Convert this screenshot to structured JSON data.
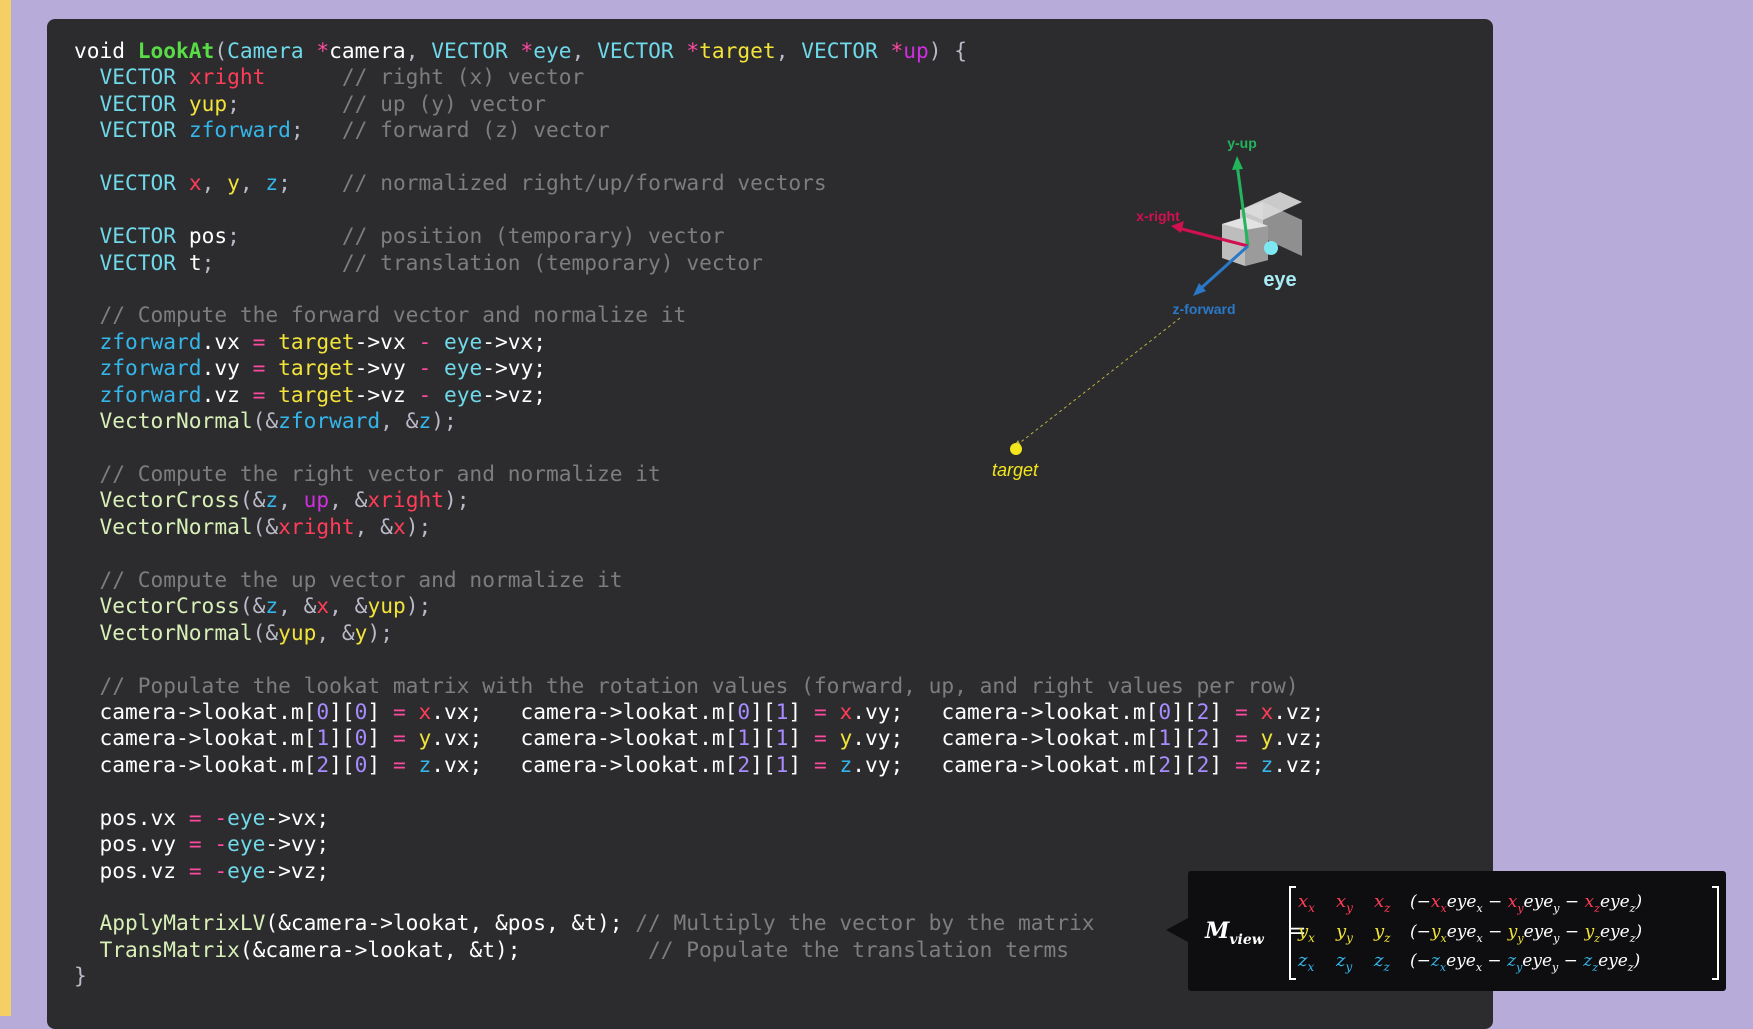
{
  "colors": {
    "background": "#b6abd9",
    "panel": "#2c2c2e",
    "left_stripe": "#f3cf66",
    "keyword": "#ffffff",
    "type": "#6fd8e9",
    "function_name": "#59dd46",
    "call": "#d8f0b8",
    "operator": "#ff4aa2",
    "comment": "#7d7d7d",
    "x_red": "#ff3d58",
    "y_yellow": "#f2e33a",
    "z_cyan": "#34b6ea",
    "up_magenta": "#d02ee0",
    "number": "#a78cff"
  },
  "code": {
    "lines": [
      [
        [
          "void ",
          "t-kw"
        ],
        [
          "LookAt",
          "t-fn"
        ],
        [
          "(",
          "t-pu"
        ],
        [
          "Camera ",
          "t-ty"
        ],
        [
          "*",
          "t-op"
        ],
        [
          "camera",
          "t-wh"
        ],
        [
          ", ",
          "t-pu"
        ],
        [
          "VECTOR ",
          "t-ty"
        ],
        [
          "*",
          "t-op"
        ],
        [
          "eye",
          "t-ty"
        ],
        [
          ", ",
          "t-pu"
        ],
        [
          "VECTOR ",
          "t-ty"
        ],
        [
          "*",
          "t-op"
        ],
        [
          "target",
          "t-yel"
        ],
        [
          ", ",
          "t-pu"
        ],
        [
          "VECTOR ",
          "t-ty"
        ],
        [
          "*",
          "t-op"
        ],
        [
          "up",
          "t-mag"
        ],
        [
          ") {",
          "t-pu"
        ]
      ],
      [
        [
          "  VECTOR ",
          "t-ty"
        ],
        [
          "xright",
          "t-red"
        ],
        [
          "      ",
          "t-pu"
        ],
        [
          "// right (x) vector",
          "t-cm"
        ]
      ],
      [
        [
          "  VECTOR ",
          "t-ty"
        ],
        [
          "yup",
          "t-yel"
        ],
        [
          ";        ",
          "t-pu"
        ],
        [
          "// up (y) vector",
          "t-cm"
        ]
      ],
      [
        [
          "  VECTOR ",
          "t-ty"
        ],
        [
          "zforward",
          "t-cyan"
        ],
        [
          ";   ",
          "t-pu"
        ],
        [
          "// forward (z) vector",
          "t-cm"
        ]
      ],
      [],
      [
        [
          "  VECTOR ",
          "t-ty"
        ],
        [
          "x",
          "t-red"
        ],
        [
          ", ",
          "t-pu"
        ],
        [
          "y",
          "t-yel"
        ],
        [
          ", ",
          "t-pu"
        ],
        [
          "z",
          "t-cyan"
        ],
        [
          ";    ",
          "t-pu"
        ],
        [
          "// normalized right/up/forward vectors",
          "t-cm"
        ]
      ],
      [],
      [
        [
          "  VECTOR ",
          "t-ty"
        ],
        [
          "pos",
          "t-wh"
        ],
        [
          ";        ",
          "t-pu"
        ],
        [
          "// position (temporary) vector",
          "t-cm"
        ]
      ],
      [
        [
          "  VECTOR ",
          "t-ty"
        ],
        [
          "t",
          "t-wh"
        ],
        [
          ";          ",
          "t-pu"
        ],
        [
          "// translation (temporary) vector",
          "t-cm"
        ]
      ],
      [],
      [
        [
          "  // Compute the forward vector and normalize it",
          "t-cm"
        ]
      ],
      [
        [
          "  ",
          "t-pu"
        ],
        [
          "zforward",
          "t-cyan"
        ],
        [
          ".vx ",
          "t-wh"
        ],
        [
          "= ",
          "t-op"
        ],
        [
          "target",
          "t-yel"
        ],
        [
          "->vx ",
          "t-wh"
        ],
        [
          "- ",
          "t-op"
        ],
        [
          "eye",
          "t-ty"
        ],
        [
          "->vx;",
          "t-wh"
        ]
      ],
      [
        [
          "  ",
          "t-pu"
        ],
        [
          "zforward",
          "t-cyan"
        ],
        [
          ".vy ",
          "t-wh"
        ],
        [
          "= ",
          "t-op"
        ],
        [
          "target",
          "t-yel"
        ],
        [
          "->vy ",
          "t-wh"
        ],
        [
          "- ",
          "t-op"
        ],
        [
          "eye",
          "t-ty"
        ],
        [
          "->vy;",
          "t-wh"
        ]
      ],
      [
        [
          "  ",
          "t-pu"
        ],
        [
          "zforward",
          "t-cyan"
        ],
        [
          ".vz ",
          "t-wh"
        ],
        [
          "= ",
          "t-op"
        ],
        [
          "target",
          "t-yel"
        ],
        [
          "->vz ",
          "t-wh"
        ],
        [
          "- ",
          "t-op"
        ],
        [
          "eye",
          "t-ty"
        ],
        [
          "->vz;",
          "t-wh"
        ]
      ],
      [
        [
          "  VectorNormal",
          "t-call"
        ],
        [
          "(&",
          "t-pu"
        ],
        [
          "zforward",
          "t-cyan"
        ],
        [
          ", &",
          "t-pu"
        ],
        [
          "z",
          "t-cyan"
        ],
        [
          ");",
          "t-pu"
        ]
      ],
      [],
      [
        [
          "  // Compute the right vector and normalize it",
          "t-cm"
        ]
      ],
      [
        [
          "  VectorCross",
          "t-call"
        ],
        [
          "(&",
          "t-pu"
        ],
        [
          "z",
          "t-cyan"
        ],
        [
          ", ",
          "t-pu"
        ],
        [
          "up",
          "t-mag"
        ],
        [
          ", &",
          "t-pu"
        ],
        [
          "xright",
          "t-red"
        ],
        [
          ");",
          "t-pu"
        ]
      ],
      [
        [
          "  VectorNormal",
          "t-call"
        ],
        [
          "(&",
          "t-pu"
        ],
        [
          "xright",
          "t-red"
        ],
        [
          ", &",
          "t-pu"
        ],
        [
          "x",
          "t-red"
        ],
        [
          ");",
          "t-pu"
        ]
      ],
      [],
      [
        [
          "  // Compute the up vector and normalize it",
          "t-cm"
        ]
      ],
      [
        [
          "  VectorCross",
          "t-call"
        ],
        [
          "(&",
          "t-pu"
        ],
        [
          "z",
          "t-cyan"
        ],
        [
          ", &",
          "t-pu"
        ],
        [
          "x",
          "t-red"
        ],
        [
          ", &",
          "t-pu"
        ],
        [
          "yup",
          "t-yel"
        ],
        [
          ");",
          "t-pu"
        ]
      ],
      [
        [
          "  VectorNormal",
          "t-call"
        ],
        [
          "(&",
          "t-pu"
        ],
        [
          "yup",
          "t-yel"
        ],
        [
          ", &",
          "t-pu"
        ],
        [
          "y",
          "t-yel"
        ],
        [
          ");",
          "t-pu"
        ]
      ],
      [],
      [
        [
          "  // Populate the lookat matrix with the rotation values (forward, up, and right values per row)",
          "t-cm"
        ]
      ],
      [
        [
          "  camera->lookat.m[",
          "t-wh"
        ],
        [
          "0",
          "t-num"
        ],
        [
          "][",
          "t-wh"
        ],
        [
          "0",
          "t-num"
        ],
        [
          "] ",
          "t-wh"
        ],
        [
          "= ",
          "t-op"
        ],
        [
          "x",
          "t-red"
        ],
        [
          ".vx;   ",
          "t-wh"
        ],
        [
          "camera->lookat.m[",
          "t-wh"
        ],
        [
          "0",
          "t-num"
        ],
        [
          "][",
          "t-wh"
        ],
        [
          "1",
          "t-num"
        ],
        [
          "] ",
          "t-wh"
        ],
        [
          "= ",
          "t-op"
        ],
        [
          "x",
          "t-red"
        ],
        [
          ".vy;   ",
          "t-wh"
        ],
        [
          "camera->lookat.m[",
          "t-wh"
        ],
        [
          "0",
          "t-num"
        ],
        [
          "][",
          "t-wh"
        ],
        [
          "2",
          "t-num"
        ],
        [
          "] ",
          "t-wh"
        ],
        [
          "= ",
          "t-op"
        ],
        [
          "x",
          "t-red"
        ],
        [
          ".vz;",
          "t-wh"
        ]
      ],
      [
        [
          "  camera->lookat.m[",
          "t-wh"
        ],
        [
          "1",
          "t-num"
        ],
        [
          "][",
          "t-wh"
        ],
        [
          "0",
          "t-num"
        ],
        [
          "] ",
          "t-wh"
        ],
        [
          "= ",
          "t-op"
        ],
        [
          "y",
          "t-yel"
        ],
        [
          ".vx;   ",
          "t-wh"
        ],
        [
          "camera->lookat.m[",
          "t-wh"
        ],
        [
          "1",
          "t-num"
        ],
        [
          "][",
          "t-wh"
        ],
        [
          "1",
          "t-num"
        ],
        [
          "] ",
          "t-wh"
        ],
        [
          "= ",
          "t-op"
        ],
        [
          "y",
          "t-yel"
        ],
        [
          ".vy;   ",
          "t-wh"
        ],
        [
          "camera->lookat.m[",
          "t-wh"
        ],
        [
          "1",
          "t-num"
        ],
        [
          "][",
          "t-wh"
        ],
        [
          "2",
          "t-num"
        ],
        [
          "] ",
          "t-wh"
        ],
        [
          "= ",
          "t-op"
        ],
        [
          "y",
          "t-yel"
        ],
        [
          ".vz;",
          "t-wh"
        ]
      ],
      [
        [
          "  camera->lookat.m[",
          "t-wh"
        ],
        [
          "2",
          "t-num"
        ],
        [
          "][",
          "t-wh"
        ],
        [
          "0",
          "t-num"
        ],
        [
          "] ",
          "t-wh"
        ],
        [
          "= ",
          "t-op"
        ],
        [
          "z",
          "t-cyan"
        ],
        [
          ".vx;   ",
          "t-wh"
        ],
        [
          "camera->lookat.m[",
          "t-wh"
        ],
        [
          "2",
          "t-num"
        ],
        [
          "][",
          "t-wh"
        ],
        [
          "1",
          "t-num"
        ],
        [
          "] ",
          "t-wh"
        ],
        [
          "= ",
          "t-op"
        ],
        [
          "z",
          "t-cyan"
        ],
        [
          ".vy;   ",
          "t-wh"
        ],
        [
          "camera->lookat.m[",
          "t-wh"
        ],
        [
          "2",
          "t-num"
        ],
        [
          "][",
          "t-wh"
        ],
        [
          "2",
          "t-num"
        ],
        [
          "] ",
          "t-wh"
        ],
        [
          "= ",
          "t-op"
        ],
        [
          "z",
          "t-cyan"
        ],
        [
          ".vz;",
          "t-wh"
        ]
      ],
      [],
      [
        [
          "  pos.vx ",
          "t-wh"
        ],
        [
          "= -",
          "t-op"
        ],
        [
          "eye",
          "t-ty"
        ],
        [
          "->vx;",
          "t-wh"
        ]
      ],
      [
        [
          "  pos.vy ",
          "t-wh"
        ],
        [
          "= -",
          "t-op"
        ],
        [
          "eye",
          "t-ty"
        ],
        [
          "->vy;",
          "t-wh"
        ]
      ],
      [
        [
          "  pos.vz ",
          "t-wh"
        ],
        [
          "= -",
          "t-op"
        ],
        [
          "eye",
          "t-ty"
        ],
        [
          "->vz;",
          "t-wh"
        ]
      ],
      [],
      [
        [
          "  ApplyMatrixLV",
          "t-call"
        ],
        [
          "(&camera->lookat, &pos, &t); ",
          "t-wh"
        ],
        [
          "// Multiply the vector by the matrix",
          "t-cm"
        ]
      ],
      [
        [
          "  TransMatrix",
          "t-call"
        ],
        [
          "(&camera->lookat, &t);          ",
          "t-wh"
        ],
        [
          "// Populate the translation terms",
          "t-cm"
        ]
      ],
      [
        [
          "}",
          "t-pu"
        ]
      ]
    ]
  },
  "diagram": {
    "y_label": "y-up",
    "x_label": "x-right",
    "z_label": "z-forward",
    "eye_label": "eye",
    "target_label": "target",
    "icon": "camera-cube-icon"
  },
  "matrix": {
    "lhs_main": "M",
    "lhs_sub": "view",
    "equals": "=",
    "rows": [
      {
        "color": "#ff3d58",
        "sym": "x",
        "fourth": [
          "(−",
          "x",
          "x",
          "eye",
          "x",
          " − ",
          "x",
          "y",
          "eye",
          "y",
          " − ",
          "x",
          "z",
          "eye",
          "z",
          ")"
        ]
      },
      {
        "color": "#f2e33a",
        "sym": "y",
        "fourth": [
          "(−",
          "y",
          "x",
          "eye",
          "x",
          " − ",
          "y",
          "y",
          "eye",
          "y",
          " − ",
          "y",
          "z",
          "eye",
          "z",
          ")"
        ]
      },
      {
        "color": "#34b6ea",
        "sym": "z",
        "fourth": [
          "(−",
          "z",
          "x",
          "eye",
          "x",
          " − ",
          "z",
          "y",
          "eye",
          "y",
          " − ",
          "z",
          "z",
          "eye",
          "z",
          ")"
        ]
      }
    ],
    "subs": [
      "x",
      "y",
      "z"
    ]
  }
}
